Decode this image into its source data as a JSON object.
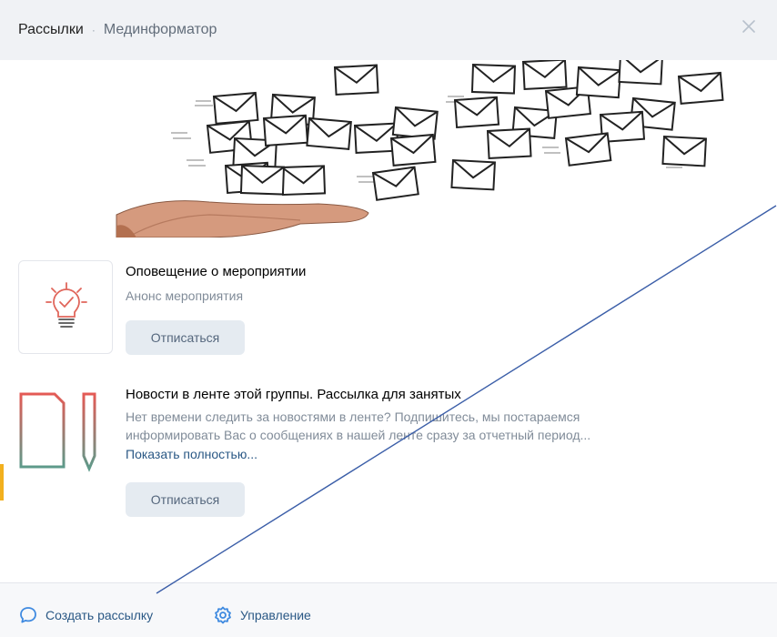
{
  "header": {
    "section": "Рассылки",
    "separator": "·",
    "group": "Мединформатор"
  },
  "subscriptions": [
    {
      "title": "Оповещение о мероприятии",
      "description": "Анонс мероприятия",
      "button": "Отписаться",
      "icon": "lightbulb-icon"
    },
    {
      "title": "Новости в ленте этой группы. Рассылка для занятых",
      "description_line1": "Нет времени следить за новостями в ленте? Подпишитесь, мы постараемся",
      "description_line2": "информировать Вас о сообщениях в нашей ленте сразу за отчетный период...",
      "more": "Показать полностью...",
      "button": "Отписаться",
      "icon": "document-pencil-icon"
    }
  ],
  "footer": {
    "create": "Создать рассылку",
    "manage": "Управление"
  },
  "colors": {
    "accent": "#2a5885",
    "header_bg": "#f0f2f5",
    "button_bg": "#e5ebf1",
    "annotation_line": "#3b5ea8"
  }
}
